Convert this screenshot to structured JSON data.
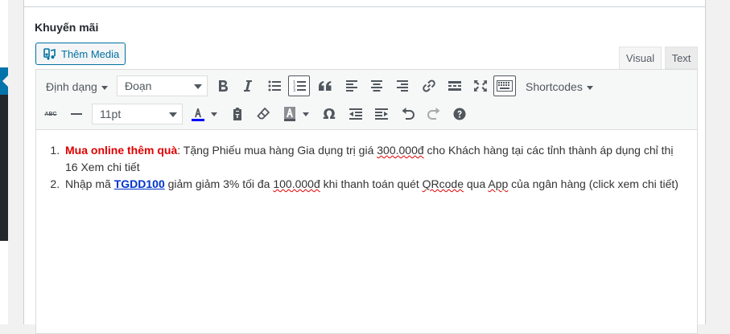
{
  "metabox": {
    "title": "Khuyến mãi",
    "media_button": "Thêm Media"
  },
  "tabs": [
    {
      "label": "Visual",
      "active": true
    },
    {
      "label": "Text",
      "active": false
    }
  ],
  "toolbar": {
    "row1": {
      "formats_menu": "Định dạng",
      "block_select": "Đoạn",
      "shortcodes_menu": "Shortcodes"
    },
    "row2": {
      "font_size": "11pt",
      "strikethrough_text": "ABC",
      "omega_symbol": "Ω",
      "text_color": "#0000ff",
      "bg_color_swatch": "#8c8f94"
    },
    "icons": [
      "bold-icon",
      "italic-icon",
      "bullet-list-icon",
      "numbered-list-icon",
      "blockquote-icon",
      "align-left-icon",
      "align-center-icon",
      "align-right-icon",
      "link-icon",
      "read-more-icon",
      "fullscreen-icon",
      "toolbar-toggle-icon",
      "strikethrough-icon",
      "horizontal-line-icon",
      "text-color-icon",
      "paste-text-icon",
      "clear-formatting-icon",
      "background-color-icon",
      "special-character-icon",
      "outdent-icon",
      "indent-icon",
      "undo-icon",
      "redo-icon",
      "help-icon"
    ]
  },
  "content": {
    "items": [
      {
        "highlight": "Mua online thêm quà",
        "highlight_color": "#e00000",
        "t1": ": Tặng Phiếu mua hàng Gia dụng trị giá ",
        "amount": "300.000đ",
        "t2": " cho Khách hàng tại các tỉnh thành áp dụng chỉ thị 16 Xem chi tiết"
      },
      {
        "t1": "Nhập mã ",
        "code": "TGDD100",
        "t2": " giảm giảm 3% tối đa ",
        "amount": "100.000đ",
        "t3": " khi thanh toán quét ",
        "qr": "QRcode",
        "t4": " qua ",
        "app": "App",
        "t5": " của ngân hàng (click xem chi tiết)"
      }
    ]
  }
}
